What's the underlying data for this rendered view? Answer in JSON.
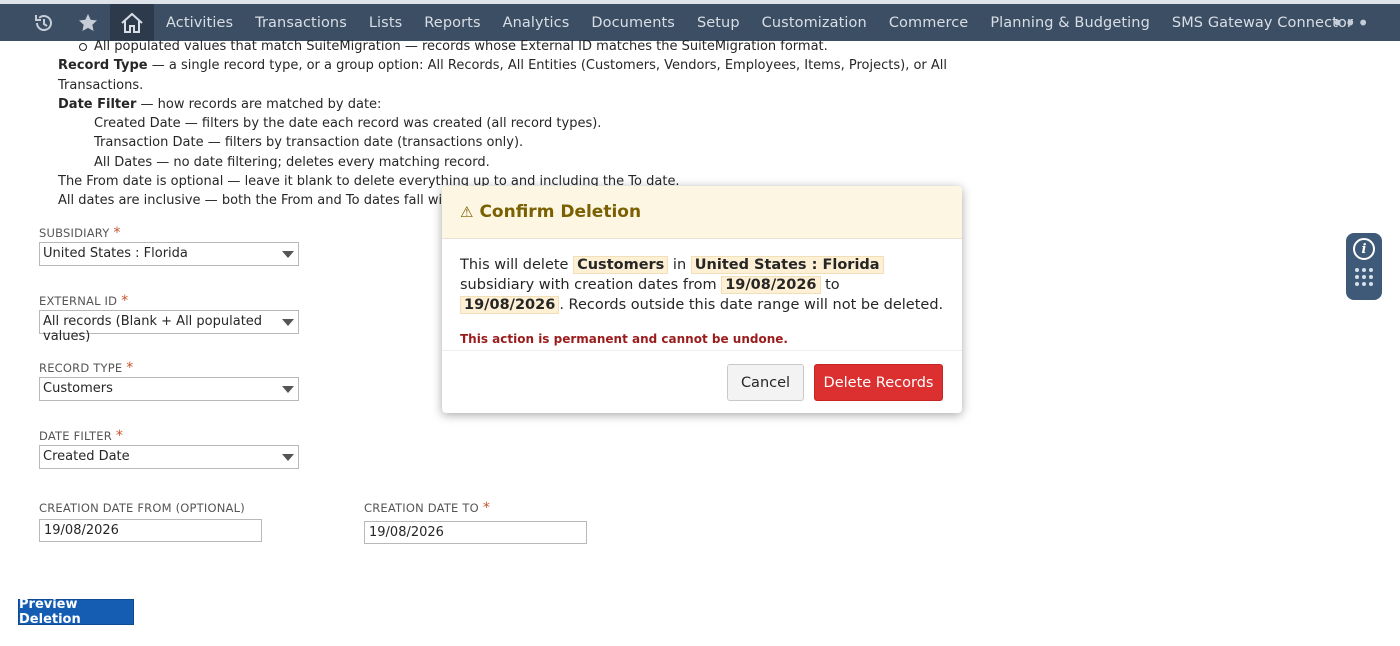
{
  "nav": {
    "items": [
      "Activities",
      "Transactions",
      "Lists",
      "Reports",
      "Analytics",
      "Documents",
      "Setup",
      "Customization",
      "Commerce",
      "Planning & Budgeting",
      "SMS Gateway Connector"
    ],
    "more": "•••"
  },
  "instructions": {
    "line1": "All populated values that match SuiteMigration — records whose External ID matches the SuiteMigration format.",
    "record_type_label": "Record Type",
    "record_type_text": " — a single record type, or a group option: All Records, All Entities (Customers, Vendors, Employees, Items, Projects), or All Transactions.",
    "date_filter_label": "Date Filter",
    "date_filter_text": " — how records are matched by date:",
    "opt_created": "Created Date — filters by the date each record was created (all record types).",
    "opt_transaction": "Transaction Date — filters by transaction date (transactions only).",
    "opt_all": "All Dates — no date filtering; deletes every matching record.",
    "note1": "The From date is optional — leave it blank to delete everything up to and including the To date.",
    "note2": "All dates are inclusive — both the From and To dates fall within the deletion range."
  },
  "form": {
    "subsidiary": {
      "label": "Subsidiary",
      "value": "United States : Florida"
    },
    "external_id": {
      "label": "External ID",
      "value": "All records (Blank + All populated values)"
    },
    "record_type": {
      "label": "Record Type",
      "value": "Customers"
    },
    "date_filter": {
      "label": "Date Filter",
      "value": "Created Date"
    },
    "date_from": {
      "label": "Creation Date From (Optional)",
      "value": "19/08/2026"
    },
    "date_to": {
      "label": "Creation Date To",
      "value": "19/08/2026"
    },
    "required_mark": "*",
    "preview_button": "Preview Deletion"
  },
  "modal": {
    "warn_icon": "⚠",
    "title": "Confirm Deletion",
    "text_1": "This will delete ",
    "record_type": "Customers",
    "text_2": " in ",
    "subsidiary": "United States : Florida",
    "text_3": " subsidiary with creation dates from ",
    "date_from": "19/08/2026",
    "text_4": " to ",
    "date_to": "19/08/2026",
    "text_5": ". Records outside this date range will not be deleted.",
    "warning": "This action is permanent and cannot be undone.",
    "cancel": "Cancel",
    "delete": "Delete Records"
  },
  "side_panel": {
    "info_icon": "i"
  }
}
